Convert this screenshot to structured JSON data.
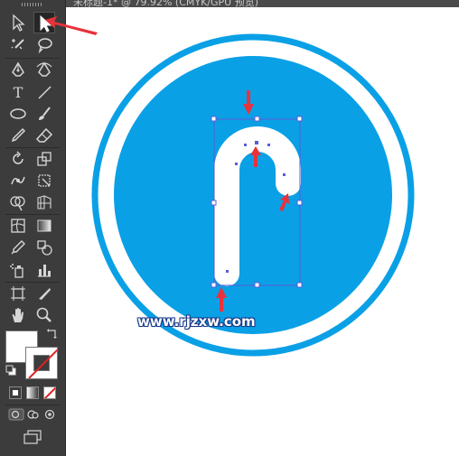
{
  "window": {
    "title_fragment": "未标题-1* @ 79.92% (CMYK/GPU 预览)"
  },
  "toolbar": {
    "tools": [
      {
        "name": "selection-tool",
        "icon": "arrow-icon"
      },
      {
        "name": "direct-selection-tool",
        "icon": "hollow-arrow-icon",
        "active": true
      },
      {
        "name": "magic-wand-tool",
        "icon": "magic-wand-icon"
      },
      {
        "name": "lasso-tool",
        "icon": "lasso-icon"
      },
      {
        "name": "pen-tool",
        "icon": "pen-icon"
      },
      {
        "name": "curvature-tool",
        "icon": "curvature-pen-icon"
      },
      {
        "name": "type-tool",
        "icon": "type-icon",
        "label": "T"
      },
      {
        "name": "line-tool",
        "icon": "line-icon"
      },
      {
        "name": "ellipse-tool",
        "icon": "ellipse-icon"
      },
      {
        "name": "paintbrush-tool",
        "icon": "brush-icon"
      },
      {
        "name": "pencil-tool",
        "icon": "pencil-icon"
      },
      {
        "name": "eraser-tool",
        "icon": "eraser-icon"
      },
      {
        "name": "rotate-tool",
        "icon": "rotate-icon"
      },
      {
        "name": "scale-tool",
        "icon": "scale-icon"
      },
      {
        "name": "warp-tool",
        "icon": "warp-icon"
      },
      {
        "name": "free-transform-tool",
        "icon": "free-transform-icon"
      },
      {
        "name": "shape-builder-tool",
        "icon": "shape-builder-icon"
      },
      {
        "name": "perspective-grid-tool",
        "icon": "perspective-grid-icon"
      },
      {
        "name": "mesh-tool",
        "icon": "mesh-icon"
      },
      {
        "name": "gradient-tool",
        "icon": "gradient-icon"
      },
      {
        "name": "eyedropper-tool",
        "icon": "eyedropper-icon"
      },
      {
        "name": "blend-tool",
        "icon": "blend-icon"
      },
      {
        "name": "symbol-sprayer-tool",
        "icon": "symbol-sprayer-icon"
      },
      {
        "name": "column-graph-tool",
        "icon": "column-graph-icon"
      },
      {
        "name": "artboard-tool",
        "icon": "artboard-icon"
      },
      {
        "name": "slice-tool",
        "icon": "slice-icon"
      },
      {
        "name": "hand-tool",
        "icon": "hand-icon"
      },
      {
        "name": "zoom-tool",
        "icon": "zoom-icon"
      }
    ]
  },
  "colors": {
    "toolbar_bg": "#3c3c3c",
    "sign_blue": "#0aa0e6",
    "sign_white": "#ffffff",
    "selection_outline": "#5b5bd6",
    "annotation_arrow": "#e8323c"
  },
  "watermark": {
    "text": "www.rjzxw.com"
  }
}
